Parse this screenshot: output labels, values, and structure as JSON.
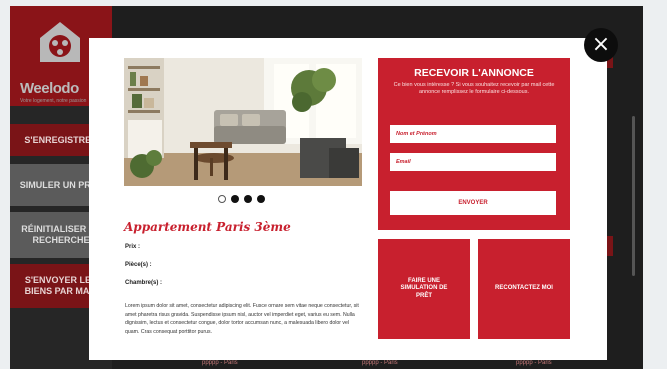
{
  "background": {
    "logo_text": "Weelodo",
    "logo_sub": "Votre logement, notre passion",
    "nav": [
      {
        "label": "S'ENREGISTRER"
      },
      {
        "label": "SIMULER UN PRÊT"
      },
      {
        "label": "RÉINITIALISER LA RECHERCHE"
      },
      {
        "label": "S'ENVOYER LES BIENS PAR MAIL"
      }
    ],
    "card_labels": [
      "ppppp - Paris",
      "ppppp - Paris",
      "ppppp - Paris"
    ]
  },
  "modal": {
    "close_icon": "×",
    "carousel": {
      "total": 4,
      "active_index": 0
    },
    "listing": {
      "title": "Appartement Paris 3ème",
      "prix_label": "Prix :",
      "pieces_label": "Pièce(s) :",
      "chambres_label": "Chambre(s) :",
      "description": "Lorem ipsum dolor sit amet, consectetur adipiscing elit. Fusce ornare sem vitae neque consectetur, sit amet pharetra risus gravida. Suspendisse ipsum nisl, auctor vel imperdiet eget, varius eu sem. Nulla dignissim, lectus et consectetur congue, dolor tortor accumsan nunc, a malesuada libero dolor vel quam. Cras consequat porttitor purus."
    },
    "form": {
      "title": "RECEVOIR L'ANNONCE",
      "subtitle": "Ce bien vous intéresse ? Si vous souhaitez recevoir par mail cette annonce remplissez le formulaire ci-dessous.",
      "name_placeholder": "Nom et Prénom",
      "email_placeholder": "Email",
      "send_label": "ENVOYER"
    },
    "actions": {
      "simulation_label": "FAIRE UNE SIMULATION DE PRÊT",
      "contact_label": "RECONTACTEZ MOI"
    }
  },
  "colors": {
    "brand_red": "#c8202e",
    "overlay": "#1e1e1e"
  }
}
